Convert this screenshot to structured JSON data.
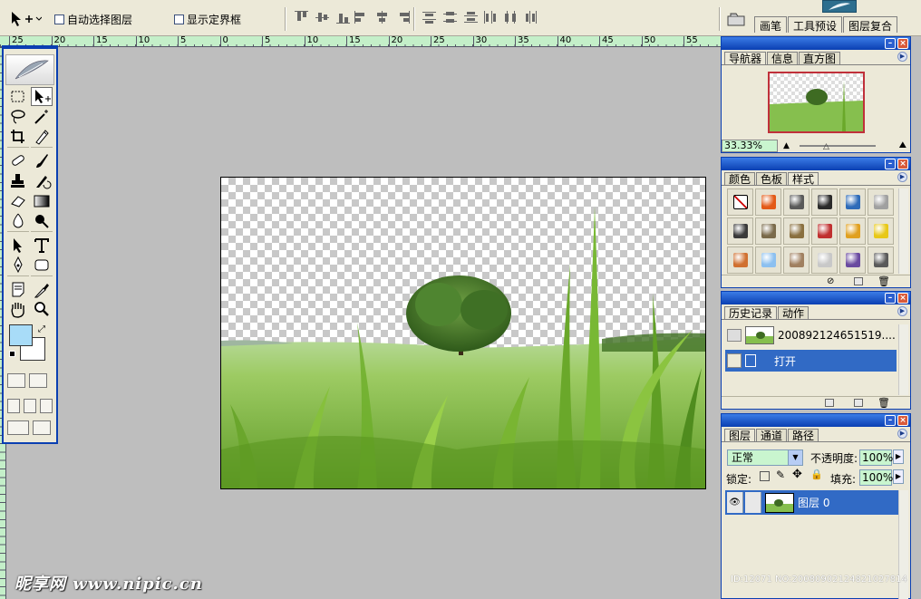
{
  "options_bar": {
    "auto_select_label": "自动选择图层",
    "show_bounds_label": "显示定界框"
  },
  "palette_well": {
    "tabs": [
      "画笔",
      "工具预设",
      "图层复合"
    ]
  },
  "ruler": {
    "ticks": [
      "25",
      "20",
      "15",
      "10",
      "5",
      "0",
      "5",
      "10",
      "15",
      "20",
      "25",
      "30",
      "35",
      "40",
      "45",
      "50",
      "55"
    ]
  },
  "navigator": {
    "tabs": [
      "导航器",
      "信息",
      "直方图"
    ],
    "zoom": "33.33%"
  },
  "styles_panel": {
    "tabs": [
      "颜色",
      "色板",
      "样式"
    ],
    "swatches": [
      "#ffffff",
      "#e35a18",
      "#5a5a5a",
      "#2a2a2a",
      "#2e6bb8",
      "#a0a0a0",
      "#3a3a3a",
      "#7a6a4a",
      "#8a7040",
      "#c03030",
      "#e0a020",
      "#e8c818",
      "#d07030",
      "#8cc0f0",
      "#a08060",
      "#c8c8c8",
      "#6a4aa0",
      "#5a5a5a"
    ]
  },
  "history_panel": {
    "tabs": [
      "历史记录",
      "动作"
    ],
    "snapshot_name": "200892124651519....",
    "step_label": "打开"
  },
  "layers_panel": {
    "tabs": [
      "图层",
      "通道",
      "路径"
    ],
    "blend_mode": "正常",
    "opacity_label": "不透明度:",
    "opacity_value": "100%",
    "lock_label": "锁定:",
    "fill_label": "填充:",
    "fill_value": "100%",
    "layer_name": "图层 0"
  },
  "watermark": {
    "left": "昵享网 www.nipic.cn",
    "right": "ID:12071 NO:20080902124821027814"
  }
}
